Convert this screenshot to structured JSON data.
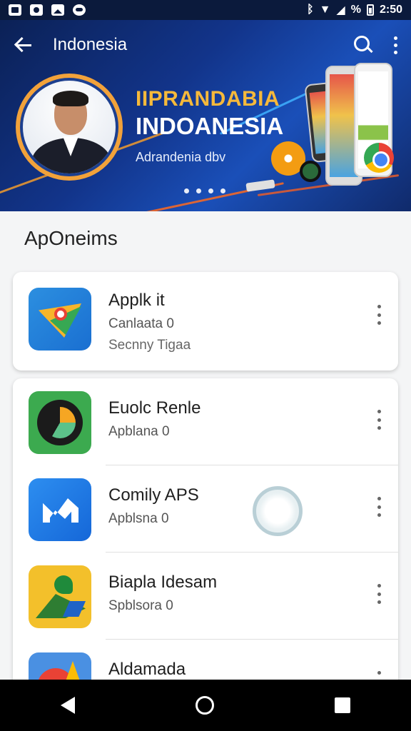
{
  "status_bar": {
    "time": "2:50",
    "signal_text": "%"
  },
  "app_bar": {
    "title": "Indonesia"
  },
  "hero": {
    "brand": "IIPRANDABIA",
    "country": "INDOANESIA",
    "subtitle": "Adrandenia dbv",
    "page_count": 4,
    "accent_color": "#f6b93b"
  },
  "section": {
    "title": "ApOneims"
  },
  "featured_card": {
    "name": "Applk it",
    "line1": "Canlaata 0",
    "line2": "Secnny Tigaa",
    "icon": "maps-icon"
  },
  "list_items": [
    {
      "name": "Euolc Renle",
      "sub": "Apblana 0",
      "icon": "clock-app-icon"
    },
    {
      "name": "Comily APS",
      "sub": "Apblsna 0",
      "icon": "m-app-icon"
    },
    {
      "name": "Biapla Idesam",
      "sub": "Spblsora 0",
      "icon": "drive-app-icon"
    },
    {
      "name": "Aldamada",
      "sub": "",
      "icon": "red-app-icon"
    }
  ]
}
